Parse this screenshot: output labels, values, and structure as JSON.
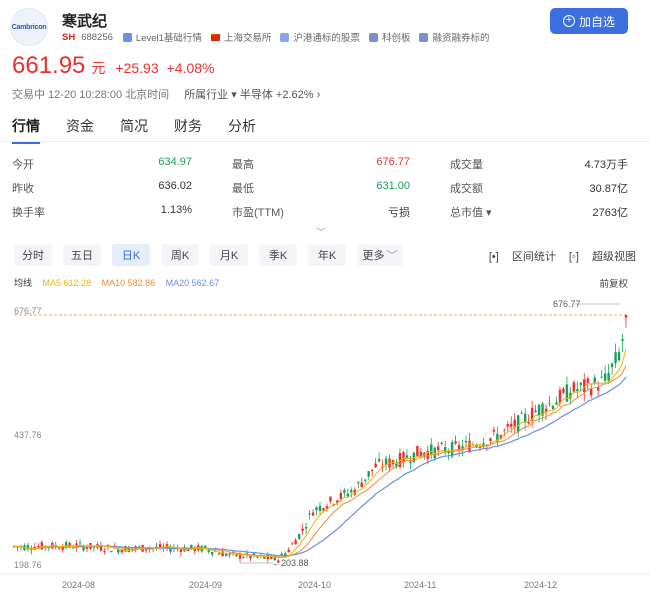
{
  "header": {
    "logo_text": "Cambricon",
    "name": "寒武纪",
    "market": "SH",
    "code": "688256",
    "tags": [
      "Level1基础行情",
      "上海交易所",
      "沪港通标的股票",
      "科创板",
      "融资融券标的"
    ],
    "add_button": "加自选"
  },
  "quote": {
    "price": "661.95",
    "unit": "元",
    "change": "+25.93",
    "change_pct": "+4.08%",
    "status": "交易中 12-20 10:28:00 北京时间",
    "industry_label": "所属行业",
    "industry": "半导体",
    "industry_change": "+2.62%"
  },
  "tabs": [
    "行情",
    "资金",
    "简况",
    "财务",
    "分析"
  ],
  "stats": [
    [
      {
        "label": "今开",
        "value": "634.97"
      },
      {
        "label": "最高",
        "value": "676.77"
      },
      {
        "label": "成交量",
        "value": "4.73万手"
      }
    ],
    [
      {
        "label": "昨收",
        "value": "636.02"
      },
      {
        "label": "最低",
        "value": "631.00"
      },
      {
        "label": "成交额",
        "value": "30.87亿"
      }
    ],
    [
      {
        "label": "换手率",
        "value": "1.13%"
      },
      {
        "label": "市盈(TTM)",
        "value": "亏损"
      },
      {
        "label": "总市值",
        "value": "2763亿"
      }
    ]
  ],
  "periods": [
    "分时",
    "五日",
    "日K",
    "周K",
    "月K",
    "季K",
    "年K",
    "更多"
  ],
  "active_period": "日K",
  "tools": {
    "range_stats": "区间统计",
    "super_view": "超级视图"
  },
  "ma": {
    "label": "均线",
    "ma5": "MA5 612.28",
    "ma10": "MA10 582.86",
    "ma20": "MA20 562.67",
    "adjust": "前复权"
  },
  "colors": {
    "up": "#e93030",
    "down": "#18a058",
    "ma5": "#f0b400",
    "ma10": "#f08a3c",
    "ma20": "#6c8fe0",
    "accent": "#3b6fe0"
  },
  "chart_data": {
    "type": "candlestick",
    "y_labels": [
      "676.77",
      "437.76",
      "198.76"
    ],
    "max_label": "676.77",
    "min_label": "203.88",
    "x_labels": [
      "2024-08",
      "2024-09",
      "2024-10",
      "2024-11",
      "2024-12"
    ],
    "ylim": [
      198.76,
      676.77
    ]
  }
}
